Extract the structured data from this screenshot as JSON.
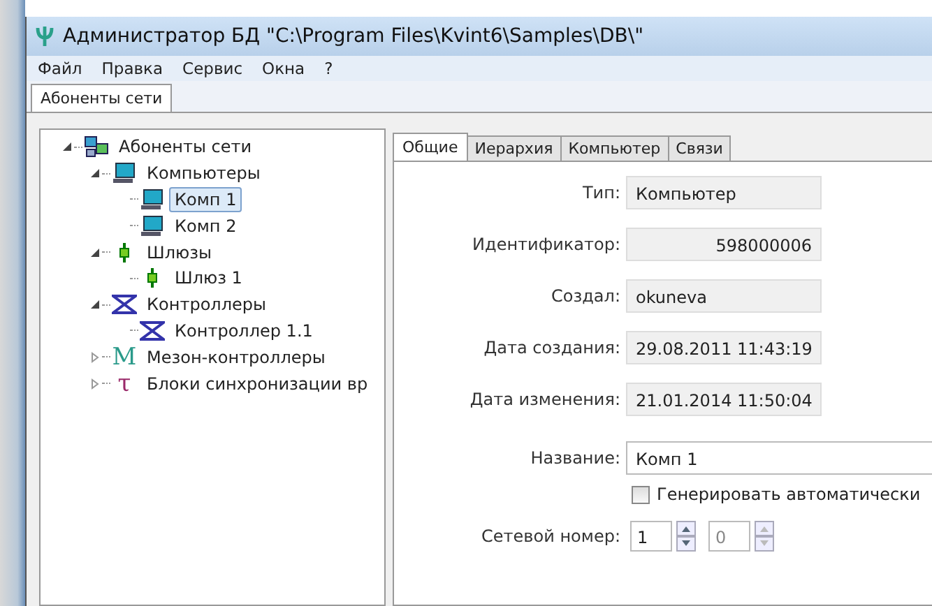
{
  "window": {
    "title": "Администратор БД \"C:\\Program Files\\Kvint6\\Samples\\DB\\\""
  },
  "menu": [
    "Файл",
    "Правка",
    "Сервис",
    "Окна",
    "?"
  ],
  "doc_tabs": [
    {
      "label": "Абоненты сети",
      "selected": true
    }
  ],
  "tree": [
    {
      "label": "Абоненты сети",
      "kind": "network",
      "selected": false,
      "expanded": true,
      "children": [
        {
          "label": "Компьютеры",
          "kind": "computer",
          "selected": false,
          "expanded": true,
          "children": [
            {
              "label": "Комп 1",
              "kind": "computer",
              "selected": true
            },
            {
              "label": "Комп 2",
              "kind": "computer",
              "selected": false
            }
          ]
        },
        {
          "label": "Шлюзы",
          "kind": "gateway",
          "selected": false,
          "expanded": true,
          "children": [
            {
              "label": "Шлюз 1",
              "kind": "gateway",
              "selected": false
            }
          ]
        },
        {
          "label": "Контроллеры",
          "kind": "controller",
          "selected": false,
          "expanded": true,
          "children": [
            {
              "label": "Контроллер 1.1",
              "kind": "controller",
              "selected": false
            }
          ]
        },
        {
          "label": "Мезон-контроллеры",
          "kind": "glyph",
          "glyph": "M",
          "color": "#2a9a8a",
          "selected": false,
          "expanded": false
        },
        {
          "label": "Блоки синхронизации вр",
          "kind": "glyph",
          "glyph": "τ",
          "color": "#9a2a6a",
          "selected": false,
          "expanded": false
        }
      ]
    }
  ],
  "tabs": [
    {
      "label": "Общие",
      "selected": true
    },
    {
      "label": "Иерархия",
      "selected": false
    },
    {
      "label": "Компьютер",
      "selected": false
    },
    {
      "label": "Связи",
      "selected": false
    }
  ],
  "fields": [
    {
      "label": "Тип:",
      "value": "Компьютер",
      "readonly": true,
      "kind": "text"
    },
    {
      "label": "Идентификатор:",
      "value": "598000006",
      "readonly": true,
      "kind": "number"
    },
    {
      "label": "Создал:",
      "value": "okuneva",
      "readonly": true,
      "kind": "text"
    },
    {
      "label": "Дата создания:",
      "value": "29.08.2011 11:43:19",
      "readonly": true,
      "kind": "text"
    },
    {
      "label": "Дата изменения:",
      "value": "21.01.2014 11:50:04",
      "readonly": true,
      "kind": "text"
    }
  ],
  "name_field": {
    "label": "Название:",
    "value": "Комп 1"
  },
  "auto_generate": {
    "label": "Генерировать автоматически",
    "checked": false
  },
  "network_number": {
    "label": "Сетевой номер:",
    "values": [
      "1",
      "0"
    ]
  }
}
